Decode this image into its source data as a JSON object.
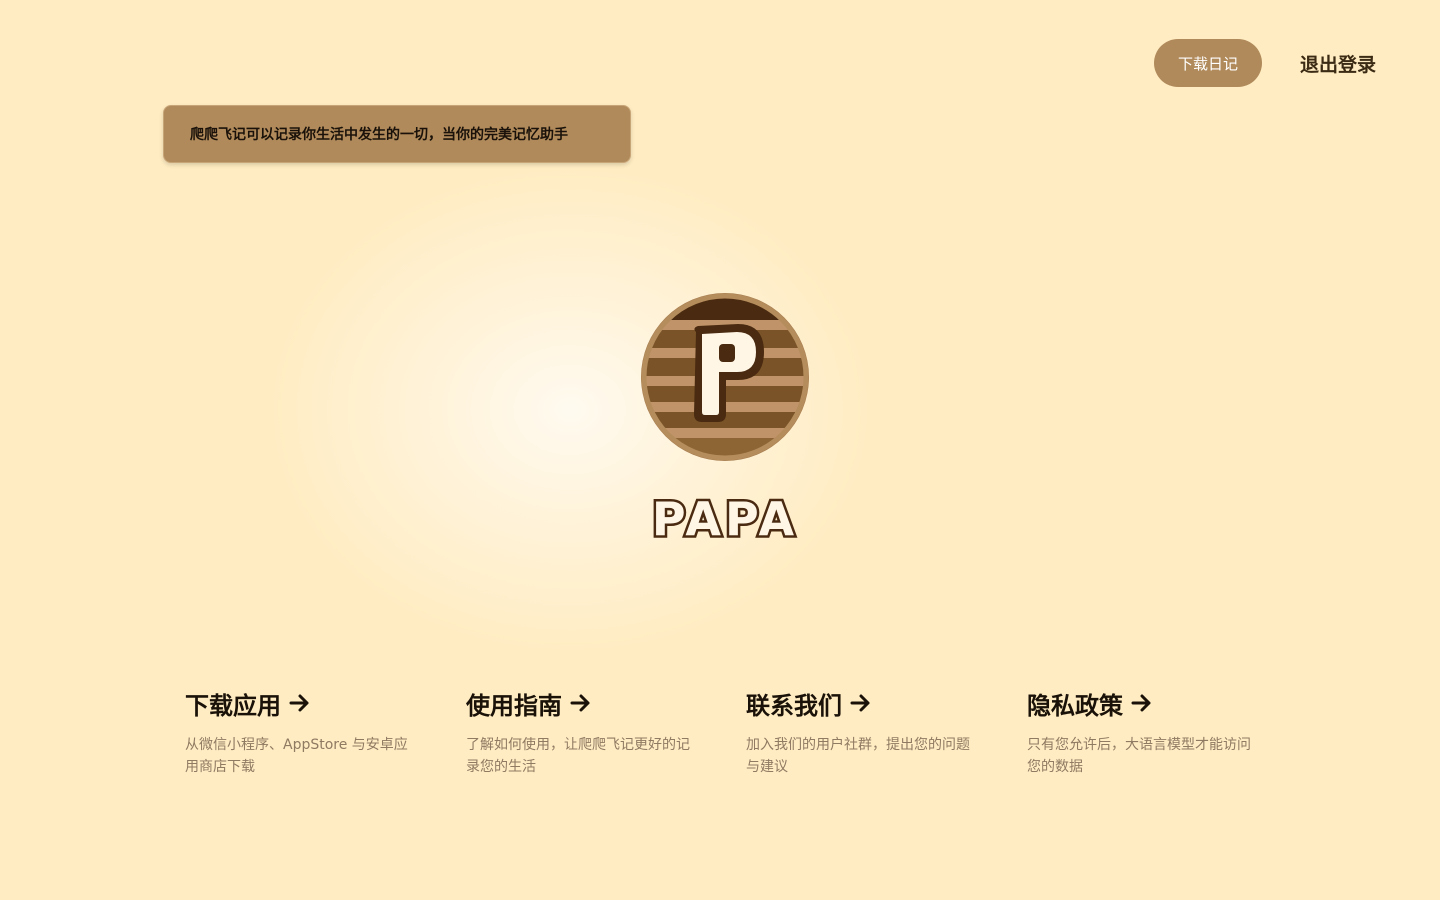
{
  "header": {
    "download_label": "下载日记",
    "logout_label": "退出登录"
  },
  "tagline": "爬爬飞记可以记录你生活中发生的一切，当你的完美记忆助手",
  "brand": {
    "logo_letter": "P",
    "wordmark": "PAPA"
  },
  "colors": {
    "background": "#ffecc2",
    "accent": "#b08a5a",
    "dark_brown": "#4a2a10"
  },
  "features": [
    {
      "title": "下载应用",
      "desc": "从微信小程序、AppStore 与安卓应用商店下载",
      "icon": "arrow-right-icon"
    },
    {
      "title": "使用指南",
      "desc": "了解如何使用，让爬爬飞记更好的记录您的生活",
      "icon": "arrow-right-icon"
    },
    {
      "title": "联系我们",
      "desc": "加入我们的用户社群，提出您的问题与建议",
      "icon": "arrow-right-icon"
    },
    {
      "title": "隐私政策",
      "desc": "只有您允许后，大语言模型才能访问您的数据",
      "icon": "arrow-right-icon"
    }
  ]
}
